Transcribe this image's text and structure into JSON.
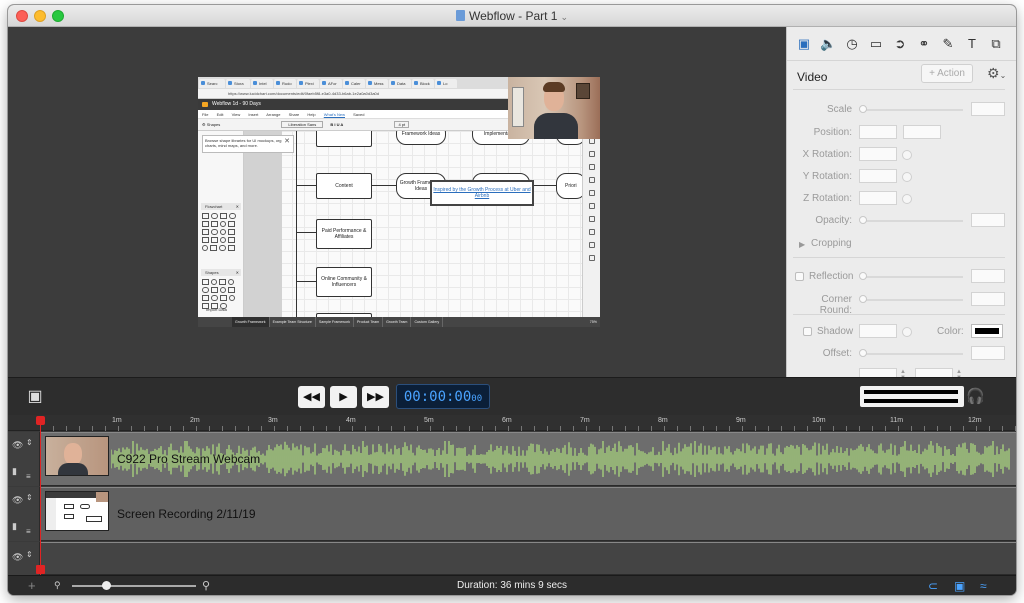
{
  "window": {
    "title": "Webflow - Part 1"
  },
  "preview": {
    "browser_tabs": [
      "Searc",
      "Stora",
      "Intel",
      "Rudo",
      "Plexi",
      "AFor",
      "Caler",
      "Mess",
      "Data",
      "Block",
      "Lo"
    ],
    "address": "https://www.lucidchart.com/documents/edit/0faeb5f8-e3a0-4d33-b6ab-1e2a0a0d3a0d",
    "doc_title": "Webflow 1d - 90 Days",
    "menu": [
      "File",
      "Edit",
      "View",
      "Insert",
      "Arrange",
      "Share",
      "Help"
    ],
    "menu_link": "What's New",
    "menu_saved": "Saved",
    "shapes_label": "Shapes",
    "font_name": "Liberation Sans",
    "font_size": "4 pt",
    "tip_text": "Browse shape libraries for UI mockups, org charts, mind maps, and more.",
    "flowchart_label": "Flowchart",
    "shapes_section_label": "Shapes",
    "import_label": "Import Data",
    "nodes": {
      "content": "Content",
      "paid": "Paid Performance & Affiliates",
      "community": "Online Community & Influencers",
      "framework_top": "Framework Ideas",
      "implementation_top": "Implementation",
      "growth_ideas": "Growth Framework Ideas",
      "growth_ranking": "Growth Ranking -> Implementation",
      "prior": "Priori"
    },
    "link_text": "Inspired by the Growth Process at Uber and Airbnb",
    "bottom_tabs": [
      "Growth Framework",
      "Example Team Structure",
      "Sample Framework",
      "Product Team",
      "Growth Team",
      "Custom Gallery"
    ],
    "zoom": "75%"
  },
  "panel": {
    "tab_icons": [
      "film-icon",
      "speaker-icon",
      "timer-icon",
      "screen-icon",
      "cursor-icon",
      "filter-icon",
      "pen-icon",
      "text-icon",
      "transform-icon"
    ],
    "heading": "Video",
    "action_label": "+ Action",
    "labels": {
      "scale": "Scale",
      "position": "Position:",
      "x_rotation": "X Rotation:",
      "y_rotation": "Y Rotation:",
      "z_rotation": "Z Rotation:",
      "opacity": "Opacity:",
      "cropping": "Cropping",
      "reflection": "Reflection",
      "corner_round": "Corner Round:",
      "shadow": "Shadow",
      "color": "Color:",
      "offset": "Offset:"
    },
    "shadow_color": "#000000"
  },
  "transport": {
    "timecode_main": "00:00:00",
    "timecode_frames": "00"
  },
  "timeline": {
    "ruler_ticks": [
      "1m",
      "2m",
      "3m",
      "4m",
      "5m",
      "6m",
      "7m",
      "8m",
      "9m",
      "10m",
      "11m",
      "12m"
    ],
    "tracks": [
      {
        "label": "C922 Pro Stream Webcam"
      },
      {
        "label": "Screen Recording 2/11/19"
      }
    ],
    "waveform_color": "#a6d07c"
  },
  "footer": {
    "duration": "Duration: 36 mins 9 secs"
  }
}
